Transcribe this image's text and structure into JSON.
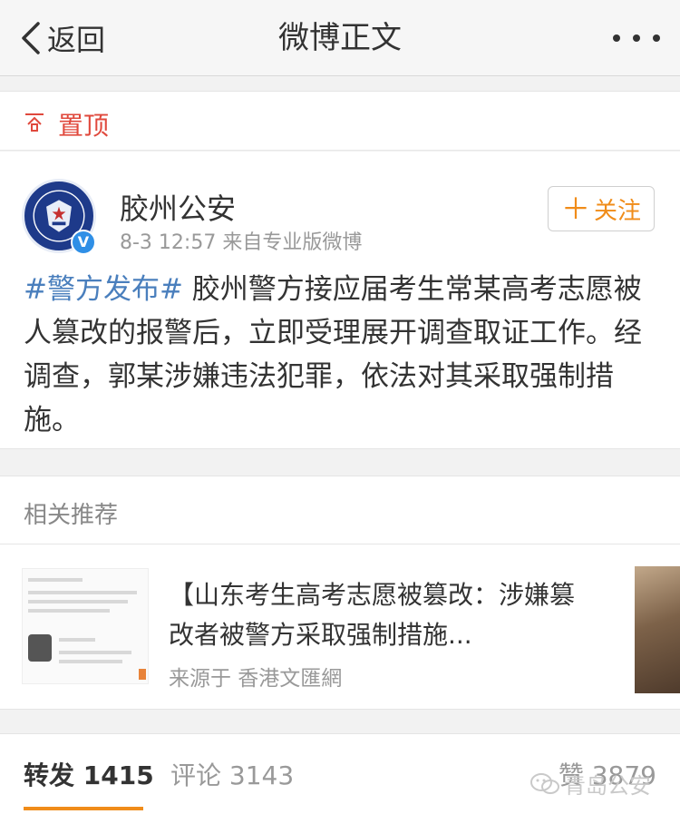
{
  "navbar": {
    "back_label": "返回",
    "title": "微博正文",
    "more_icon": "more-dots-icon"
  },
  "pinned": {
    "icon": "pin-top-icon",
    "label": "置顶",
    "color": "#e0493d"
  },
  "post": {
    "author": "胶州公安",
    "avatar_icon": "police-badge-icon",
    "verified_icon": "verified-badge-icon",
    "time": "8-3 12:57",
    "source": "来自专业版微博",
    "follow_label": "关注",
    "follow_plus": "＋",
    "hashtag": "#警方发布#",
    "body": " 胶州警方接应届考生常某高考志愿被人篡改的报警后，立即受理展开调查取证工作。经调查，郭某涉嫌违法犯罪，依法对其采取强制措施。",
    "hashtag_color": "#4a7fbd",
    "accent_color": "#f08c19"
  },
  "related": {
    "section_title": "相关推荐",
    "headline": "【山东考生高考志愿被篡改：涉嫌篡改者被警方采取强制措施...",
    "source": "来源于 香港文匯網"
  },
  "stats": {
    "repost_label": "转发",
    "repost_count": "1415",
    "comment_label": "评论",
    "comment_count": "3143",
    "like_label": "赞",
    "like_count": "3879"
  },
  "watermark": {
    "icon": "wechat-icon",
    "text": "青岛公安"
  }
}
